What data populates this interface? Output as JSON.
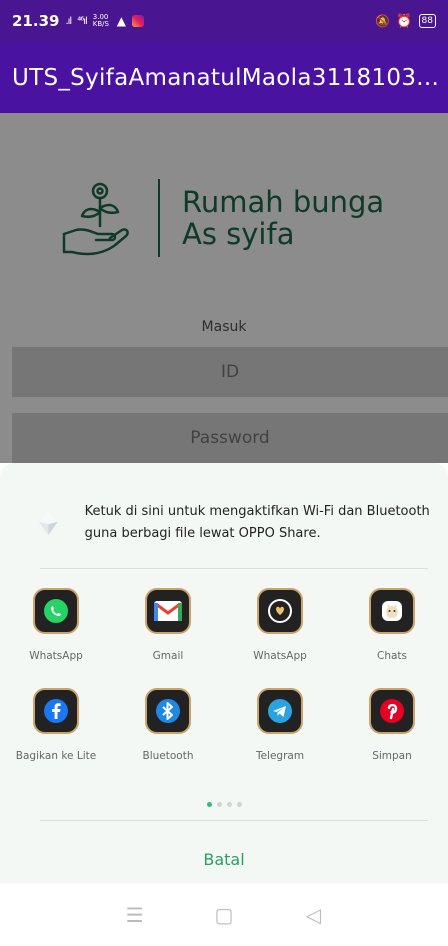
{
  "status_bar": {
    "time": "21.39",
    "signal_1": ".ıl",
    "signal_2": "⁴⁶ıl",
    "net_speed": "3.00 KB/S",
    "battery": "88"
  },
  "app_bar": {
    "title": "UTS_SyifaAmanatulMaola3118103..."
  },
  "login": {
    "brand_line1": "Rumah bunga",
    "brand_line2": "As syifa",
    "heading": "Masuk",
    "id_placeholder": "ID",
    "password_placeholder": "Password"
  },
  "share_sheet": {
    "hint": "Ketuk di sini untuk mengaktifkan Wi-Fi dan Bluetooth guna berbagi file lewat OPPO Share.",
    "apps": [
      {
        "label": "WhatsApp",
        "icon": "whatsapp-icon",
        "color": "#25d366"
      },
      {
        "label": "Gmail",
        "icon": "gmail-icon",
        "color": "#ea4335"
      },
      {
        "label": "WhatsApp",
        "icon": "whatsapp-business-icon",
        "color": "#e9c46a"
      },
      {
        "label": "Chats",
        "icon": "chats-icon",
        "color": "#f1e0c0"
      },
      {
        "label": "Bagikan ke Lite",
        "icon": "facebook-lite-icon",
        "color": "#1877f2"
      },
      {
        "label": "Bluetooth",
        "icon": "bluetooth-icon",
        "color": "#1e88e5"
      },
      {
        "label": "Telegram",
        "icon": "telegram-icon",
        "color": "#2aa3e0"
      },
      {
        "label": "Simpan",
        "icon": "pinterest-icon",
        "color": "#e60023"
      }
    ],
    "cancel_label": "Batal"
  },
  "colors": {
    "status_bar": "#4a1591",
    "app_bar": "#4a12a0",
    "brand_green": "#1d6b4b",
    "accent_green": "#2a9f63"
  }
}
